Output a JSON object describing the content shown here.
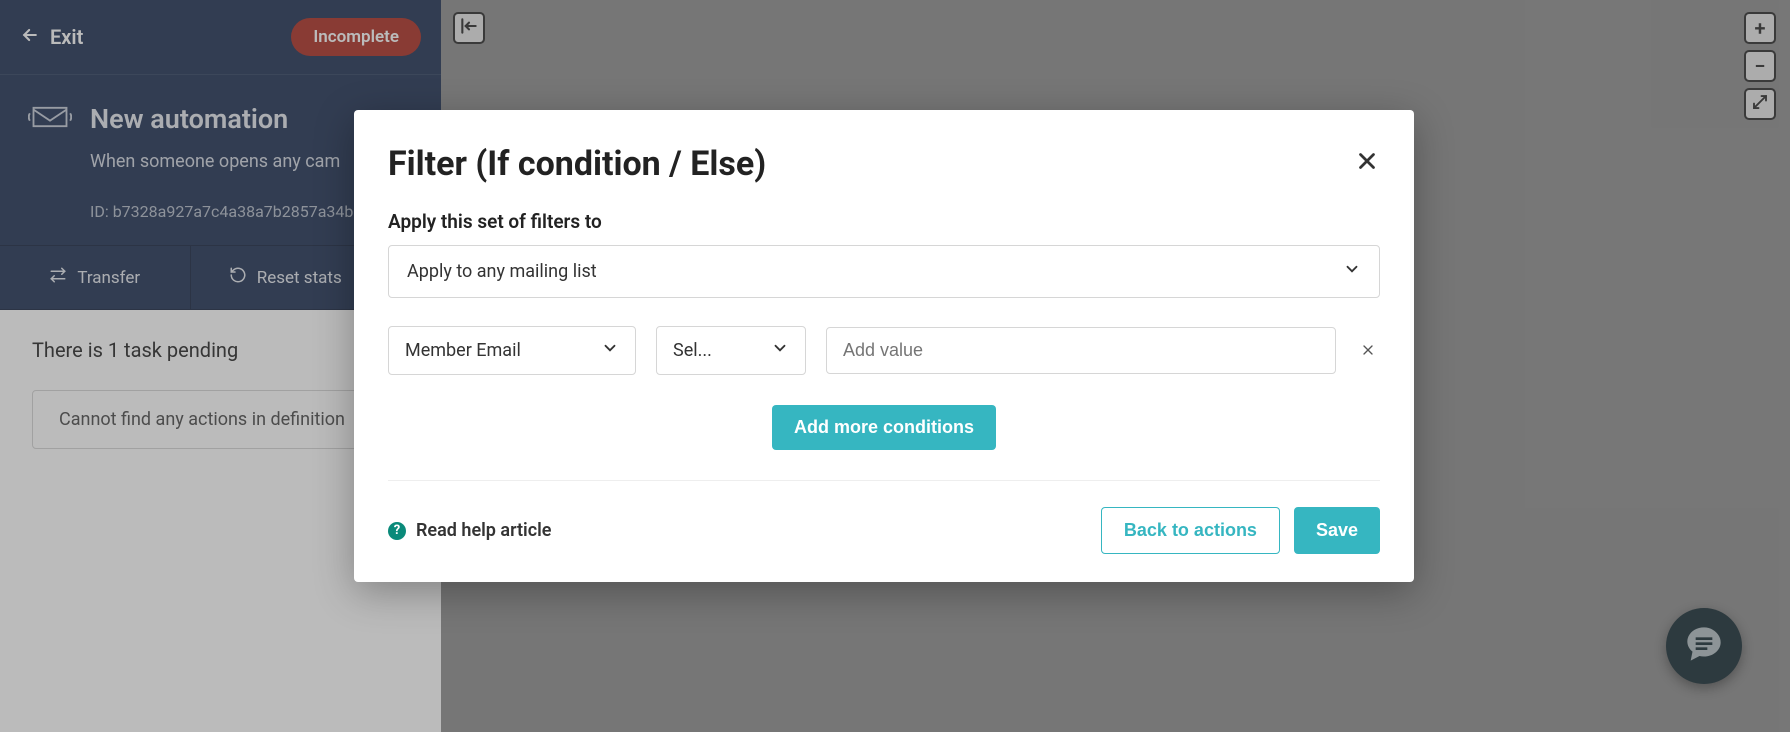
{
  "sidebar": {
    "exit_label": "Exit",
    "status_badge": "Incomplete",
    "title": "New automation",
    "subtitle": "When someone opens any cam",
    "id_line": "ID: b7328a927a7c4a38a7b2857a34b",
    "actions": {
      "transfer": "Transfer",
      "reset": "Reset stats"
    },
    "pending_text": "There is 1 task pending",
    "pending_card": "Cannot find any actions in definition"
  },
  "modal": {
    "title": "Filter (If condition / Else)",
    "apply_label": "Apply this set of filters to",
    "apply_select": "Apply to any mailing list",
    "condition": {
      "field": "Member Email",
      "operator": "Sel...",
      "value_placeholder": "Add value"
    },
    "add_more": "Add more conditions",
    "help_link": "Read help article",
    "back_btn": "Back to actions",
    "save_btn": "Save"
  }
}
